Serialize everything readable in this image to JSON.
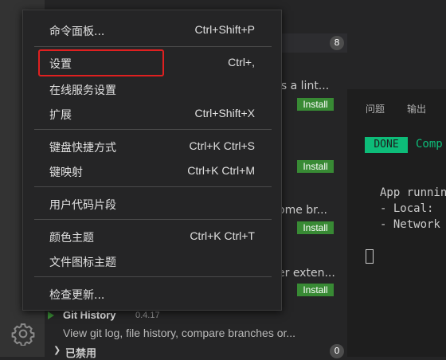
{
  "menu": {
    "items": [
      {
        "label": "命令面板...",
        "shortcut": "Ctrl+Shift+P"
      },
      {
        "label": "设置",
        "shortcut": "Ctrl+,"
      },
      {
        "label": "在线服务设置",
        "shortcut": ""
      },
      {
        "label": "扩展",
        "shortcut": "Ctrl+Shift+X"
      },
      {
        "label": "键盘快捷方式",
        "shortcut": "Ctrl+K Ctrl+S"
      },
      {
        "label": "键映射",
        "shortcut": "Ctrl+K Ctrl+M"
      },
      {
        "label": "用户代码片段",
        "shortcut": ""
      },
      {
        "label": "颜色主题",
        "shortcut": "Ctrl+K Ctrl+T"
      },
      {
        "label": "文件图标主题",
        "shortcut": ""
      },
      {
        "label": "检查更新...",
        "shortcut": ""
      }
    ]
  },
  "sidebar": {
    "enabled_count": "8",
    "fragments": [
      "is a lint...",
      "ome br...",
      "er exten..."
    ],
    "install_label": "Install",
    "git_history": {
      "title": "Git History",
      "version": "0.4.17",
      "description": "View git log, file history, compare branches or..."
    },
    "disabled_label": "已禁用",
    "disabled_count": "0"
  },
  "panel": {
    "tabs": [
      "问题",
      "输出"
    ],
    "done_badge": "DONE",
    "compiled_fragment": "Comp",
    "lines": [
      "App runnin",
      "- Local:",
      "- Network"
    ]
  },
  "colors": {
    "highlight": "#e02020",
    "install": "#388a34",
    "done": "#0dbc79"
  }
}
